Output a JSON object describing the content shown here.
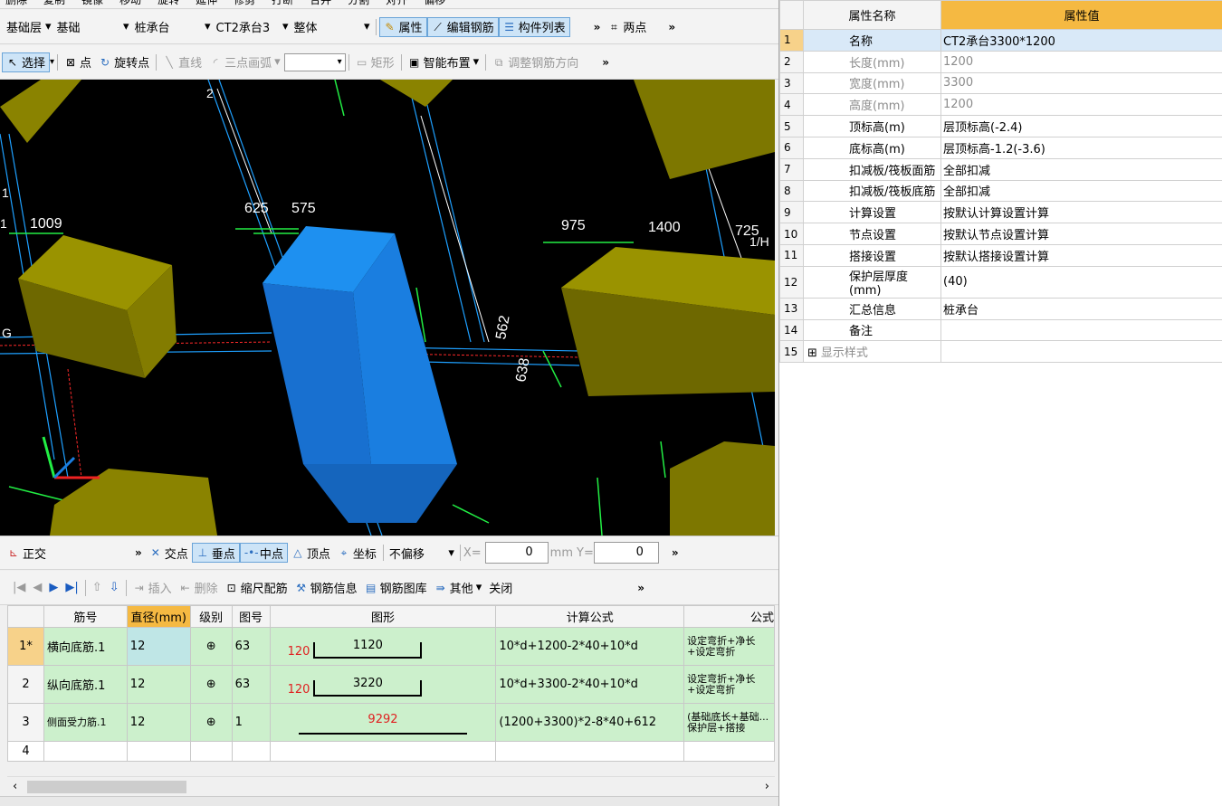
{
  "toolbar1": {
    "items": [
      "删除",
      "复制",
      "镜像",
      "移动",
      "旋转",
      "延伸",
      "修剪",
      "打断",
      "合并",
      "分割",
      "对齐",
      "偏移"
    ]
  },
  "toolbar2": {
    "floor": "基础层",
    "category": "基础",
    "type": "桩承台",
    "component": "CT2承台3",
    "scope": "整体",
    "attr_label": "属性",
    "edit_rebar_label": "编辑钢筋",
    "component_list_label": "构件列表",
    "two_points_label": "两点",
    "more": "»"
  },
  "toolbar3": {
    "select_label": "选择",
    "point_label": "点",
    "rotate_point_label": "旋转点",
    "line_label": "直线",
    "arc_label": "三点画弧",
    "rect_label": "矩形",
    "smart_layout_label": "智能布置",
    "adjust_direction_label": "调整钢筋方向",
    "more": "»"
  },
  "viewport": {
    "dims": {
      "d1009": "1009",
      "d625": "625",
      "d575": "575",
      "d975": "975",
      "d1400": "1400",
      "d725": "725",
      "d562": "562",
      "d638": "638"
    },
    "axis_labels": {
      "a1": "1",
      "a1b": "1",
      "g": "G",
      "two": "2",
      "hatch": "1/H"
    }
  },
  "snapbar": {
    "ortho_label": "正交",
    "intersect_label": "交点",
    "perp_label": "垂点",
    "mid_label": "中点",
    "vertex_label": "顶点",
    "coord_label": "坐标",
    "offset_label": "不偏移",
    "x_label": "X=",
    "x_value": "0",
    "mm_label": "mm",
    "y_label": "Y=",
    "y_value": "0",
    "more": "»"
  },
  "rebar_toolbar": {
    "insert_label": "插入",
    "delete_label": "删除",
    "scale_label": "缩尺配筋",
    "info_label": "钢筋信息",
    "library_label": "钢筋图库",
    "other_label": "其他",
    "close_label": "关闭",
    "more": "»"
  },
  "rebar_table": {
    "headers": [
      "筋号",
      "直径(mm)",
      "级别",
      "图号",
      "图形",
      "计算公式",
      "公式"
    ],
    "rows": [
      {
        "num": "1*",
        "name": "横向底筋.1",
        "dia": "12",
        "grade": "⊕",
        "fig": "63",
        "hook": "120",
        "len": "1120",
        "formula": "10*d+1200-2*40+10*d",
        "desc": "设定弯折+净长+设定弯折"
      },
      {
        "num": "2",
        "name": "纵向底筋.1",
        "dia": "12",
        "grade": "⊕",
        "fig": "63",
        "hook": "120",
        "len": "3220",
        "formula": "10*d+3300-2*40+10*d",
        "desc": "设定弯折+净长+设定弯折"
      },
      {
        "num": "3",
        "name": "侧面受力筋.1",
        "dia": "12",
        "grade": "⊕",
        "fig": "1",
        "hook": "",
        "len": "9292",
        "formula": "(1200+3300)*2-8*40+612",
        "desc": "(基础底长+基础...保护层+搭接"
      },
      {
        "num": "4",
        "name": "",
        "dia": "",
        "grade": "",
        "fig": "",
        "hook": "",
        "len": "",
        "formula": "",
        "desc": ""
      }
    ]
  },
  "properties": {
    "header_name": "属性名称",
    "header_value": "属性值",
    "rows": [
      {
        "num": "1",
        "name": "名称",
        "value": "CT2承台3300*1200"
      },
      {
        "num": "2",
        "name": "长度(mm)",
        "value": "1200"
      },
      {
        "num": "3",
        "name": "宽度(mm)",
        "value": "3300"
      },
      {
        "num": "4",
        "name": "高度(mm)",
        "value": "1200"
      },
      {
        "num": "5",
        "name": "顶标高(m)",
        "value": "层顶标高(-2.4)"
      },
      {
        "num": "6",
        "name": "底标高(m)",
        "value": "层顶标高-1.2(-3.6)"
      },
      {
        "num": "7",
        "name": "扣减板/筏板面筋",
        "value": "全部扣减"
      },
      {
        "num": "8",
        "name": "扣减板/筏板底筋",
        "value": "全部扣减"
      },
      {
        "num": "9",
        "name": "计算设置",
        "value": "按默认计算设置计算"
      },
      {
        "num": "10",
        "name": "节点设置",
        "value": "按默认节点设置计算"
      },
      {
        "num": "11",
        "name": "搭接设置",
        "value": "按默认搭接设置计算"
      },
      {
        "num": "12",
        "name": "保护层厚度(mm)",
        "value": "(40)"
      },
      {
        "num": "13",
        "name": "汇总信息",
        "value": "桩承台"
      },
      {
        "num": "14",
        "name": "备注",
        "value": ""
      },
      {
        "num": "15",
        "name": "显示样式",
        "value": ""
      }
    ]
  },
  "colors": {
    "accent": "#f5b942",
    "rebar_row": "#ccf0cc",
    "viewport_bg": "#000000",
    "cap_blue": "#1a7ee0",
    "cap_olive": "#8a8300"
  }
}
